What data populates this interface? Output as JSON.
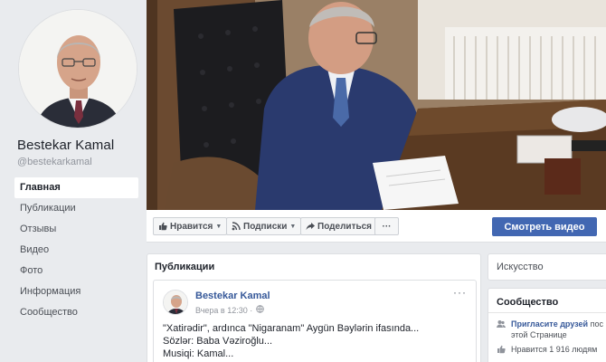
{
  "page": {
    "name": "Bestekar Kamal",
    "handle": "@bestekarkamal"
  },
  "nav": [
    {
      "label": "Главная",
      "active": true
    },
    {
      "label": "Публикации"
    },
    {
      "label": "Отзывы"
    },
    {
      "label": "Видео"
    },
    {
      "label": "Фото"
    },
    {
      "label": "Информация"
    },
    {
      "label": "Сообщество"
    }
  ],
  "actions": {
    "like": "Нравится",
    "follow": "Подписки",
    "share": "Поделиться",
    "more": "···",
    "watch_video": "Смотреть видео"
  },
  "publications": {
    "title": "Публикации",
    "post": {
      "author": "Bestekar Kamal",
      "time": "Вчера в 12:30 ·",
      "more": "···",
      "lines": [
        "\"Xatirədir\", ardınca \"Nigaranam\" Aygün Bəylərin ifasında...",
        "Sözlər: Baba Vəziroğlu...",
        "Musiqi: Kamal..."
      ]
    }
  },
  "sidebar": {
    "category": "Искусство",
    "community_title": "Сообщество",
    "invite_link": "Пригласите друзей",
    "invite_suffix": "пос",
    "invite_line2": "этой Странице",
    "likes_text": "Нравится 1 916 людям"
  },
  "colors": {
    "brand_blue": "#4267b2",
    "link_blue": "#365899",
    "page_bg": "#e9ebee"
  },
  "icons": [
    "like-icon",
    "rss-icon",
    "share-icon",
    "globe-icon",
    "people-icon",
    "thumb-icon"
  ]
}
